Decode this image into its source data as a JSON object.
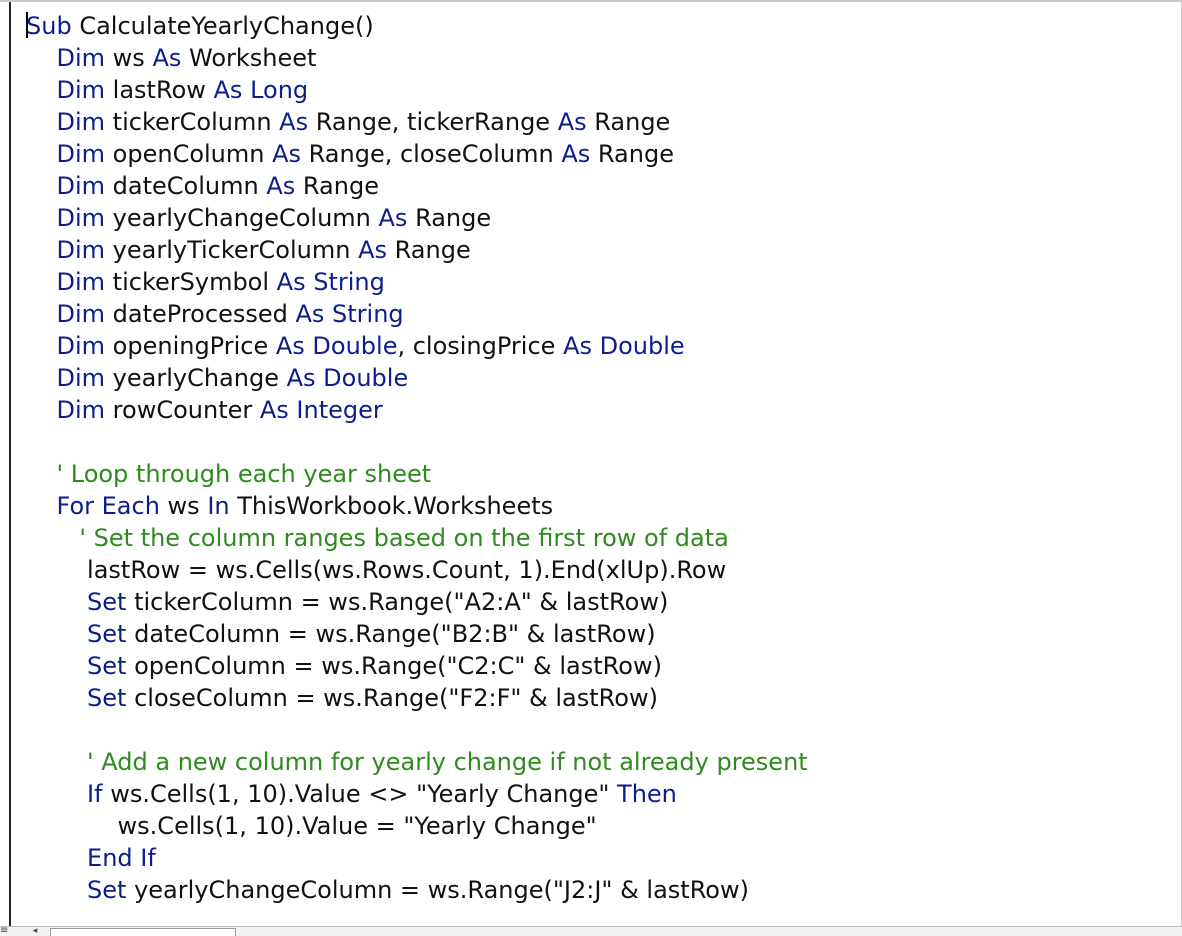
{
  "editor": {
    "lines": [
      [
        {
          "t": "Sub",
          "c": "kw"
        },
        {
          "t": " CalculateYearlyChange()"
        }
      ],
      [
        {
          "t": "    "
        },
        {
          "t": "Dim",
          "c": "kw"
        },
        {
          "t": " ws "
        },
        {
          "t": "As",
          "c": "kw"
        },
        {
          "t": " Worksheet"
        }
      ],
      [
        {
          "t": "    "
        },
        {
          "t": "Dim",
          "c": "kw"
        },
        {
          "t": " lastRow "
        },
        {
          "t": "As Long",
          "c": "kw"
        }
      ],
      [
        {
          "t": "    "
        },
        {
          "t": "Dim",
          "c": "kw"
        },
        {
          "t": " tickerColumn "
        },
        {
          "t": "As",
          "c": "kw"
        },
        {
          "t": " Range, tickerRange "
        },
        {
          "t": "As",
          "c": "kw"
        },
        {
          "t": " Range"
        }
      ],
      [
        {
          "t": "    "
        },
        {
          "t": "Dim",
          "c": "kw"
        },
        {
          "t": " openColumn "
        },
        {
          "t": "As",
          "c": "kw"
        },
        {
          "t": " Range, closeColumn "
        },
        {
          "t": "As",
          "c": "kw"
        },
        {
          "t": " Range"
        }
      ],
      [
        {
          "t": "    "
        },
        {
          "t": "Dim",
          "c": "kw"
        },
        {
          "t": " dateColumn "
        },
        {
          "t": "As",
          "c": "kw"
        },
        {
          "t": " Range"
        }
      ],
      [
        {
          "t": "    "
        },
        {
          "t": "Dim",
          "c": "kw"
        },
        {
          "t": " yearlyChangeColumn "
        },
        {
          "t": "As",
          "c": "kw"
        },
        {
          "t": " Range"
        }
      ],
      [
        {
          "t": "    "
        },
        {
          "t": "Dim",
          "c": "kw"
        },
        {
          "t": " yearlyTickerColumn "
        },
        {
          "t": "As",
          "c": "kw"
        },
        {
          "t": " Range"
        }
      ],
      [
        {
          "t": "    "
        },
        {
          "t": "Dim",
          "c": "kw"
        },
        {
          "t": " tickerSymbol "
        },
        {
          "t": "As String",
          "c": "kw"
        }
      ],
      [
        {
          "t": "    "
        },
        {
          "t": "Dim",
          "c": "kw"
        },
        {
          "t": " dateProcessed "
        },
        {
          "t": "As String",
          "c": "kw"
        }
      ],
      [
        {
          "t": "    "
        },
        {
          "t": "Dim",
          "c": "kw"
        },
        {
          "t": " openingPrice "
        },
        {
          "t": "As Double",
          "c": "kw"
        },
        {
          "t": ", closingPrice "
        },
        {
          "t": "As Double",
          "c": "kw"
        }
      ],
      [
        {
          "t": "    "
        },
        {
          "t": "Dim",
          "c": "kw"
        },
        {
          "t": " yearlyChange "
        },
        {
          "t": "As Double",
          "c": "kw"
        }
      ],
      [
        {
          "t": "    "
        },
        {
          "t": "Dim",
          "c": "kw"
        },
        {
          "t": " rowCounter "
        },
        {
          "t": "As Integer",
          "c": "kw"
        }
      ],
      [],
      [
        {
          "t": "    "
        },
        {
          "t": "' Loop through each year sheet",
          "c": "cm"
        }
      ],
      [
        {
          "t": "    "
        },
        {
          "t": "For Each",
          "c": "kw"
        },
        {
          "t": " ws "
        },
        {
          "t": "In",
          "c": "kw"
        },
        {
          "t": " ThisWorkbook.Worksheets"
        }
      ],
      [
        {
          "t": "       "
        },
        {
          "t": "' Set the column ranges based on the first row of data",
          "c": "cm"
        }
      ],
      [
        {
          "t": "        lastRow = ws.Cells(ws.Rows.Count, 1).End(xlUp).Row"
        }
      ],
      [
        {
          "t": "        "
        },
        {
          "t": "Set",
          "c": "kw"
        },
        {
          "t": " tickerColumn = ws.Range(\"A2:A\" & lastRow)"
        }
      ],
      [
        {
          "t": "        "
        },
        {
          "t": "Set",
          "c": "kw"
        },
        {
          "t": " dateColumn = ws.Range(\"B2:B\" & lastRow)"
        }
      ],
      [
        {
          "t": "        "
        },
        {
          "t": "Set",
          "c": "kw"
        },
        {
          "t": " openColumn = ws.Range(\"C2:C\" & lastRow)"
        }
      ],
      [
        {
          "t": "        "
        },
        {
          "t": "Set",
          "c": "kw"
        },
        {
          "t": " closeColumn = ws.Range(\"F2:F\" & lastRow)"
        }
      ],
      [],
      [
        {
          "t": "        "
        },
        {
          "t": "' Add a new column for yearly change if not already present",
          "c": "cm"
        }
      ],
      [
        {
          "t": "        "
        },
        {
          "t": "If",
          "c": "kw"
        },
        {
          "t": " ws.Cells(1, 10).Value <> \"Yearly Change\" "
        },
        {
          "t": "Then",
          "c": "kw"
        }
      ],
      [
        {
          "t": "            ws.Cells(1, 10).Value = \"Yearly Change\""
        }
      ],
      [
        {
          "t": "        "
        },
        {
          "t": "End If",
          "c": "kw"
        }
      ],
      [
        {
          "t": "        "
        },
        {
          "t": "Set",
          "c": "kw"
        },
        {
          "t": " yearlyChangeColumn = ws.Range(\"J2:J\" & lastRow)"
        }
      ]
    ]
  },
  "colors": {
    "keyword": "#0b1e8c",
    "comment": "#2f8a1f",
    "text": "#111111",
    "background": "#ffffff"
  },
  "statusbar": {
    "view_toggle_icon": "≡",
    "scroll_left_icon": "◂"
  }
}
